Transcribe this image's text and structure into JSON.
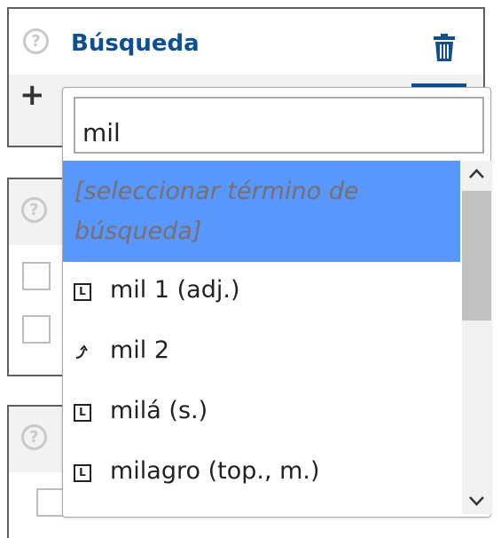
{
  "panel_main": {
    "title": "Búsqueda",
    "help_icon": "question-circle-icon",
    "delete_icon": "trash-icon",
    "add_icon": "plus-icon"
  },
  "dropdown": {
    "search_value": "mil",
    "placeholder_option": "[seleccionar término de búsqueda]",
    "options": [
      {
        "icon": "lemma-icon",
        "label": "mil 1 (adj.)"
      },
      {
        "icon": "redirect-icon",
        "label": "mil 2"
      },
      {
        "icon": "lemma-icon",
        "label": "milá (s.)"
      },
      {
        "icon": "lemma-icon",
        "label": "milagro (top., m.)"
      }
    ]
  },
  "colors": {
    "title_blue": "#0d4f8f",
    "highlight": "#5897fb",
    "placeholder_text": "#7a6e6e"
  }
}
